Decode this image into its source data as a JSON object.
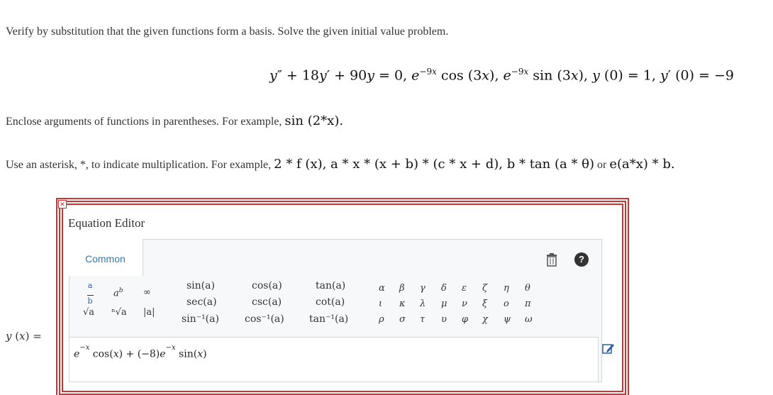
{
  "problem": {
    "instruction": "Verify by substitution that the given functions form a basis. Solve the given initial value problem.",
    "equation": "y″ + 18y′ + 90y = 0,  e−9x cos (3x),  e−9x sin (3x),  y (0) = 1,  y′ (0) = −9",
    "note_arguments": "Enclose arguments of functions in parentheses. For example,",
    "note_arguments_example": "sin (2*x).",
    "note_asterisk": "Use an asterisk, *, to indicate multiplication. For example,",
    "note_asterisk_example": "2 * f (x), a * x * (x + b) * (c * x + d), b * tan (a * θ)",
    "note_or": "or",
    "note_asterisk_example2": "e(a*x) * b."
  },
  "editor": {
    "title": "Equation Editor",
    "tab_common": "Common",
    "answer_label": "y (x) =",
    "answer_value": "e^-x cos(x) + (−8) e^-x sin(x)",
    "icons": [
      "close-icon",
      "trash-icon",
      "help-icon",
      "edit-icon"
    ],
    "templates": {
      "frac": "a/b",
      "power": "a^b",
      "infinity": "∞",
      "sqrt": "√a",
      "nthroot": "ⁿ√a",
      "abs": "|a|"
    },
    "functions": [
      [
        "sin(a)",
        "cos(a)",
        "tan(a)"
      ],
      [
        "sec(a)",
        "csc(a)",
        "cot(a)"
      ],
      [
        "sin⁻¹(a)",
        "cos⁻¹(a)",
        "tan⁻¹(a)"
      ]
    ],
    "greek": [
      [
        "α",
        "β",
        "γ",
        "δ",
        "ε",
        "ζ",
        "η",
        "θ"
      ],
      [
        "ι",
        "κ",
        "λ",
        "μ",
        "ν",
        "ξ",
        "ο",
        "π"
      ],
      [
        "ρ",
        "σ",
        "τ",
        "υ",
        "φ",
        "χ",
        "ψ",
        "ω"
      ]
    ]
  }
}
